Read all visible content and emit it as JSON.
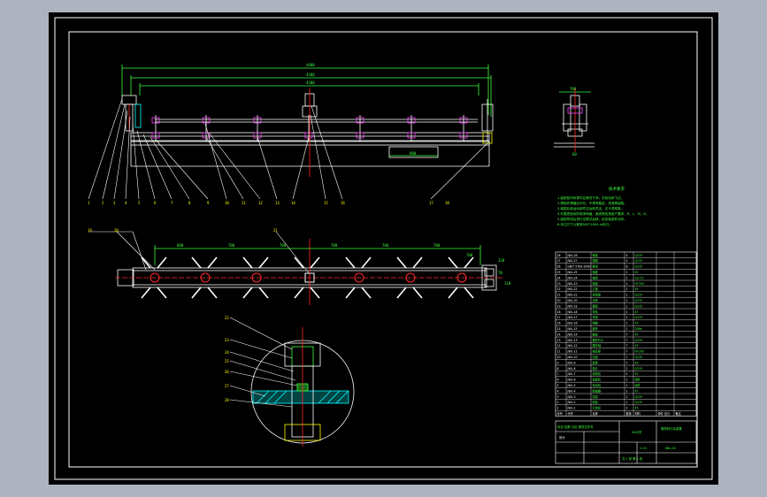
{
  "app": {
    "name": "CAD drawing viewer",
    "colors": {
      "window_bg": "#adb4bf",
      "paper": "#000000",
      "frame": "#ffffff",
      "outline": "#ffffff",
      "dimension": "#3dff3d",
      "center": "#ff2a2a",
      "hatch": "#00ffff",
      "accent": "#ffff00",
      "part": "#ff44ff"
    }
  },
  "front_view": {
    "top_dims": [
      "4400",
      "4380",
      "4300"
    ],
    "balloons": [
      "1",
      "2",
      "3",
      "4",
      "5",
      "6",
      "7",
      "8",
      "9",
      "10",
      "11",
      "12",
      "13",
      "14",
      "15",
      "16",
      "17",
      "18"
    ],
    "dim_bottom": "900"
  },
  "side_view": {
    "dims": [
      "700",
      "60",
      "210"
    ]
  },
  "top_view": {
    "balloons": [
      "19",
      "20",
      "21"
    ],
    "dims": [
      "600",
      "700",
      "700",
      "700",
      "700",
      "700",
      "700",
      "320",
      "70",
      "110"
    ]
  },
  "detail_view": {
    "balloons": [
      "22",
      "23",
      "24",
      "25",
      "26",
      "27",
      "28"
    ]
  },
  "notes": {
    "title": "技术要求",
    "lines": [
      "1.装配前所有零件应清洗干净，去除毛刺飞边。",
      "2.焊接件焊缝应均匀，不得有裂纹、夹渣等缺陷。",
      "3.装配后各运动部件应运转灵活，无卡滞现象。",
      "4.外露表面涂防锈漆两遍，面漆颜色按用户要求，R、L、M、N。",
      "5.装配完成后进行空载试运转，检查各部件动作。",
      "6.未注尺寸公差按GB/T1804-m执行。"
    ]
  },
  "bom": {
    "rows": [
      {
        "no": "28",
        "code": "JWL-28",
        "name": "螺栓",
        "qty": "4",
        "material": "Q235"
      },
      {
        "no": "27",
        "code": "JWL-27",
        "name": "垫圈",
        "qty": "4",
        "material": "Q235"
      },
      {
        "no": "26",
        "code": "GB/T 5783-2000",
        "name": "螺母",
        "qty": "8",
        "material": "Q235"
      },
      {
        "no": "25",
        "code": "JWL-25",
        "name": "轴套",
        "qty": "1",
        "material": "45"
      },
      {
        "no": "24",
        "code": "JWL-24",
        "name": "轴承",
        "qty": "2",
        "material": "GCr15"
      },
      {
        "no": "23",
        "code": "JWL-23",
        "name": "端盖",
        "qty": "1",
        "material": "HT200"
      },
      {
        "no": "22",
        "code": "JWL-22",
        "name": "立轴",
        "qty": "1",
        "material": "45"
      },
      {
        "no": "21",
        "code": "JWL-21",
        "name": "连接板",
        "qty": "1",
        "material": "Q235"
      },
      {
        "no": "20",
        "code": "JWL-20",
        "name": "支座",
        "qty": "1",
        "material": "Q235"
      },
      {
        "no": "19",
        "code": "JWL-19",
        "name": "横梁",
        "qty": "1",
        "material": "Q235"
      },
      {
        "no": "18",
        "code": "JWL-18",
        "name": "导轨",
        "qty": "2",
        "material": "45"
      },
      {
        "no": "17",
        "code": "JWL-17",
        "name": "吊架",
        "qty": "1",
        "material": "Q235"
      },
      {
        "no": "16",
        "code": "JWL-16",
        "name": "销轴",
        "qty": "1",
        "material": "45"
      },
      {
        "no": "15",
        "code": "JWL-15",
        "name": "链条",
        "qty": "1",
        "material": "20Mn"
      },
      {
        "no": "14",
        "code": "JWL-14",
        "name": "链轮",
        "qty": "7",
        "material": "45"
      },
      {
        "no": "13",
        "code": "JWL-13",
        "name": "搅拌叶片",
        "qty": "7",
        "material": "Q235"
      },
      {
        "no": "12",
        "code": "JWL-12",
        "name": "搅拌轴",
        "qty": "7",
        "material": "45"
      },
      {
        "no": "11",
        "code": "JWL-11",
        "name": "轴承座",
        "qty": "7",
        "material": "HT200"
      },
      {
        "no": "10",
        "code": "JWL-10",
        "name": "压板",
        "qty": "7",
        "material": "Q235"
      },
      {
        "no": "9",
        "code": "JWL-9",
        "name": "套筒",
        "qty": "7",
        "material": "45"
      },
      {
        "no": "8",
        "code": "JWL-8",
        "name": "垫片",
        "qty": "2",
        "material": "Q235"
      },
      {
        "no": "7",
        "code": "JWL-7",
        "name": "张紧轮",
        "qty": "1",
        "material": "45"
      },
      {
        "no": "6",
        "code": "JWL-6",
        "name": "减速机",
        "qty": "1",
        "material": "组件"
      },
      {
        "no": "5",
        "code": "JWL-5",
        "name": "电动机",
        "qty": "1",
        "material": "组件"
      },
      {
        "no": "4",
        "code": "JWL-4",
        "name": "联轴器",
        "qty": "1",
        "material": "45"
      },
      {
        "no": "3",
        "code": "JWL-3",
        "name": "机架",
        "qty": "1",
        "material": "Q235"
      },
      {
        "no": "2",
        "code": "JWL-2",
        "name": "底板",
        "qty": "1",
        "material": "Q235"
      },
      {
        "no": "1",
        "code": "JWL-1",
        "name": "行走轮",
        "qty": "2",
        "material": "45"
      }
    ],
    "header": {
      "no": "序号",
      "code": "代号",
      "name": "名称",
      "qty": "数量",
      "material": "材料",
      "weight": "单件 总计",
      "note": "备注"
    }
  },
  "title_block": {
    "designer": "设计",
    "school": "XX大学",
    "drawing_title": "搅拌机行走装置",
    "drawing_no": "JWL-00",
    "scale": "1:10",
    "sheet": "共 1 张 第 1 张",
    "mark": "标记 处数 分区 更改文件号"
  }
}
